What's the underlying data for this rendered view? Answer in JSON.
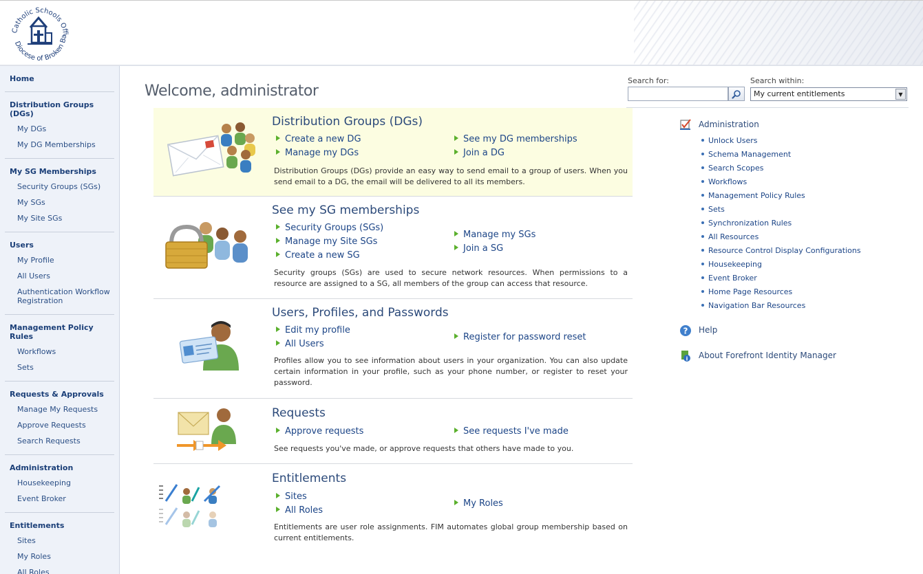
{
  "logo": {
    "line1": "Catholic Schools Office",
    "line2": "Diocese of Broken Bay"
  },
  "sidebar": {
    "home": "Home",
    "sections": [
      {
        "title": "Distribution Groups (DGs)",
        "items": [
          "My DGs",
          "My DG Memberships"
        ]
      },
      {
        "title": "My SG Memberships",
        "items": [
          "Security Groups (SGs)",
          "My SGs",
          "My Site SGs"
        ]
      },
      {
        "title": "Users",
        "items": [
          "My Profile",
          "All Users",
          "Authentication Workflow Registration"
        ]
      },
      {
        "title": "Management Policy Rules",
        "items": [
          "Workflows",
          "Sets"
        ]
      },
      {
        "title": "Requests & Approvals",
        "items": [
          "Manage My Requests",
          "Approve Requests",
          "Search Requests"
        ]
      },
      {
        "title": "Administration",
        "items": [
          "Housekeeping",
          "Event Broker"
        ]
      },
      {
        "title": "Entitlements",
        "items": [
          "Sites",
          "My Roles",
          "All Roles"
        ]
      }
    ]
  },
  "main": {
    "welcome": "Welcome, administrator",
    "search": {
      "for_label": "Search for:",
      "for_value": "",
      "within_label": "Search within:",
      "within_value": "My current entitlements"
    },
    "panels": [
      {
        "title": "Distribution Groups (DGs)",
        "links_left": [
          "Create a new DG",
          "Manage my DGs"
        ],
        "links_right": [
          "See my DG memberships",
          "Join a DG"
        ],
        "description": "Distribution Groups (DGs) provide an easy way to send email to a group of users. When you send email to a DG, the email will be delivered to all its members."
      },
      {
        "title": "See my SG memberships",
        "links_left": [
          "Security Groups (SGs)",
          "Manage my Site SGs",
          "Create a new SG"
        ],
        "links_right": [
          "Manage my SGs",
          "Join a SG"
        ],
        "description": "Security groups (SGs) are used to secure network resources. When permissions to a resource are assigned to a SG, all members of the group can access that resource."
      },
      {
        "title": "Users, Profiles, and Passwords",
        "links_left": [
          "Edit my profile",
          "All Users"
        ],
        "links_right": [
          "Register for password reset"
        ],
        "description": "Profiles allow you to see information about users in your organization. You can also update certain information in your profile, such as your phone number, or register to reset your password."
      },
      {
        "title": "Requests",
        "links_left": [
          "Approve requests"
        ],
        "links_right": [
          "See requests I've made"
        ],
        "description": "See requests you've made, or approve requests that others have made to you."
      },
      {
        "title": "Entitlements",
        "links_left": [
          "Sites",
          "All Roles"
        ],
        "links_right": [
          "My Roles"
        ],
        "description": "Entitlements are user role assignments. FIM automates global group membership based on current entitlements."
      }
    ]
  },
  "right": {
    "admin_title": "Administration",
    "admin_items": [
      "Unlock Users",
      "Schema Management",
      "Search Scopes",
      "Workflows",
      "Management Policy Rules",
      "Sets",
      "Synchronization Rules",
      "All Resources",
      "Resource Control Display Configurations",
      "Housekeeping",
      "Event Broker",
      "Home Page Resources",
      "Navigation Bar Resources"
    ],
    "help": "Help",
    "about": "About Forefront Identity Manager"
  },
  "icons": {
    "search": "magnifier-icon",
    "dropdown": "chevron-down-icon",
    "admin": "admin-checkmark-icon",
    "help": "help-question-icon",
    "about": "info-icon",
    "panel_dg": "envelope-users-icon",
    "panel_sg": "padlock-users-icon",
    "panel_users": "user-card-icon",
    "panel_requests": "envelope-request-icon",
    "panel_entitlements": "entitlements-icon"
  },
  "colors": {
    "sidebar_bg": "#eef2f9",
    "link": "#1c4587",
    "highlight": "#fcfde1",
    "bullet_triangle": "#5bb02d"
  }
}
